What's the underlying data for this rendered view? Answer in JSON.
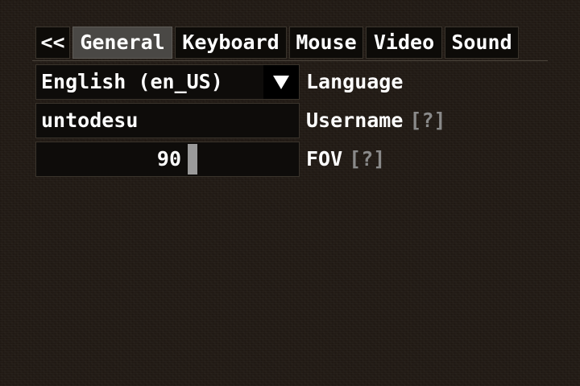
{
  "tabs": [
    {
      "id": "back",
      "label": "<<"
    },
    {
      "id": "general",
      "label": "General",
      "active": true
    },
    {
      "id": "keyboard",
      "label": "Keyboard"
    },
    {
      "id": "mouse",
      "label": "Mouse"
    },
    {
      "id": "video",
      "label": "Video"
    },
    {
      "id": "sound",
      "label": "Sound"
    }
  ],
  "settings": {
    "language": {
      "value": "English (en_US)",
      "label": "Language",
      "arrow_icon": "triangle-down-icon"
    },
    "username": {
      "value": "untodesu",
      "label": "Username",
      "help": "[?]"
    },
    "fov": {
      "value": "90",
      "label": "FOV",
      "help": "[?]",
      "slider_position": 0.6
    }
  },
  "colors": {
    "background": "#221b15",
    "field_background": "#0e0c0a",
    "active_tab": "#4a4845",
    "help_text": "#8a8a8a",
    "slider_thumb": "#9a9a9a"
  }
}
